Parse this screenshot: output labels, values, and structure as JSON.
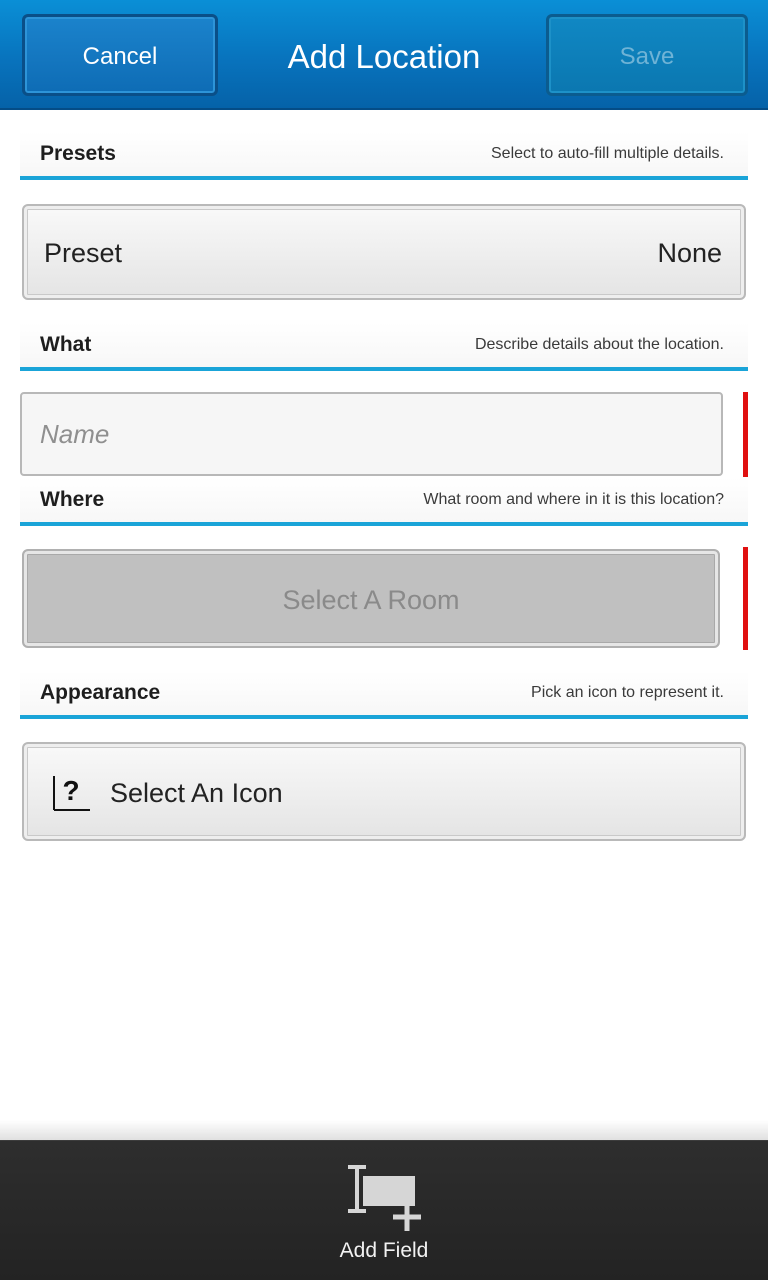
{
  "header": {
    "title": "Add Location",
    "cancel_label": "Cancel",
    "save_label": "Save"
  },
  "sections": {
    "presets": {
      "title": "Presets",
      "hint": "Select to auto-fill multiple details."
    },
    "what": {
      "title": "What",
      "hint": "Describe details about the location."
    },
    "where": {
      "title": "Where",
      "hint": "What room and where in it is this location?"
    },
    "appearance": {
      "title": "Appearance",
      "hint": "Pick an icon to represent it."
    }
  },
  "preset_picker": {
    "label": "Preset",
    "value": "None"
  },
  "name_field": {
    "value": "",
    "placeholder": "Name"
  },
  "room_picker": {
    "label": "Select A Room"
  },
  "icon_picker": {
    "label": "Select An Icon",
    "icon": "unknown-icon"
  },
  "action_bar": {
    "add_field_label": "Add Field",
    "add_field_icon": "add-field-icon"
  },
  "colors": {
    "accent": "#1aa4d8",
    "titlebar": "#0873bd",
    "required": "#e01010",
    "actionbar": "#2a2a2a"
  }
}
